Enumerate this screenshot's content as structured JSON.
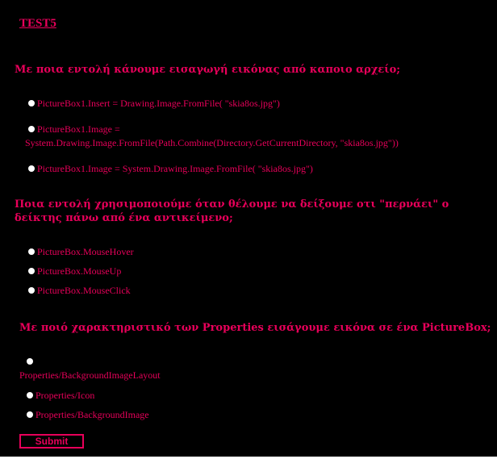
{
  "title": "TEST5",
  "questions": [
    {
      "text": "Με ποια εντολή κάνουμε εισαγωγή εικόνας από καποιο αρχείο;",
      "options": [
        "PictureBox1.Insert = Drawing.Image.FromFile( \"skia8os.jpg\")",
        {
          "line1": "PictureBox1.Image =",
          "line2": "System.Drawing.Image.FromFile(Path.Combine(Directory.GetCurrentDirectory, \"skia8os.jpg\"))"
        },
        "PictureBox1.Image = System.Drawing.Image.FromFile( \"skia8os.jpg\")"
      ]
    },
    {
      "line1": "Ποια εντολή χρησιμοποιούμε όταν θέλουμε να δείξουμε οτι \"περνάει\" ο",
      "line2": "δείκτης πάνω από ένα αντικείμενο;",
      "options": [
        "PictureBox.MouseHover",
        "PictureBox.MouseUp",
        "PictureBox.MouseClick"
      ]
    },
    {
      "text": "Με ποιό χαρακτηριστικό των Properties εισάγουμε εικόνα σε ένα PictureBox;",
      "options": [
        "Properties/BackgroundImageLayout",
        "Properties/Icon",
        "Properties/BackgroundImage"
      ]
    }
  ],
  "submit_label": "Submit",
  "colors": {
    "background": "#000000",
    "text": "#e8005a",
    "radio": "#ffffff"
  }
}
